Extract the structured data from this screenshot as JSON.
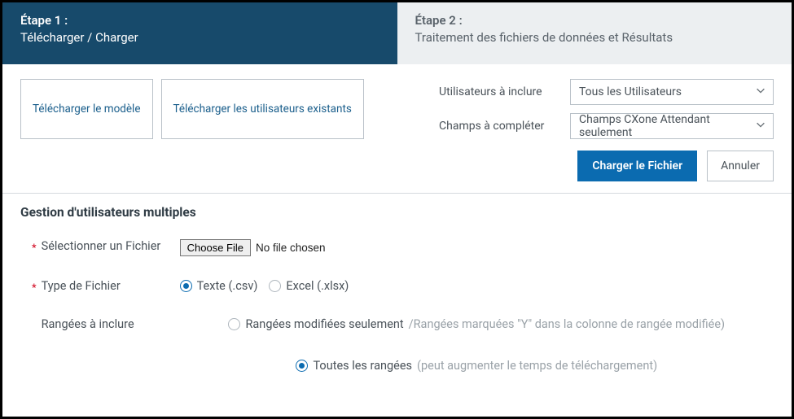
{
  "steps": {
    "step1": {
      "title": "Étape 1 :",
      "subtitle": "Télécharger / Charger"
    },
    "step2": {
      "title": "Étape 2 :",
      "subtitle": "Traitement des fichiers de données et Résultats"
    }
  },
  "buttons": {
    "download_template": "Télécharger le modèle",
    "download_existing": "Télécharger les utilisateurs existants",
    "load_file": "Charger le Fichier",
    "cancel": "Annuler",
    "choose_file": "Choose File",
    "no_file": "No file chosen"
  },
  "fields": {
    "users_to_include": {
      "label": "Utilisateurs à inclure",
      "value": "Tous les Utilisateurs"
    },
    "fields_to_complete": {
      "label": "Champs à compléter",
      "value": "Champs CXone Attendant seulement"
    }
  },
  "section": {
    "title": "Gestion d'utilisateurs multiples",
    "select_file": "Sélectionner un Fichier",
    "file_type": "Type de Fichier",
    "rows_include": "Rangées à inclure"
  },
  "filetype": {
    "csv": "Texte (.csv)",
    "xlsx": "Excel (.xlsx)"
  },
  "rows": {
    "modified": "Rangées modifiées seulement",
    "modified_hint": "/Rangées marquées \"Y\" dans la colonne de rangée modifiée)",
    "all": "Toutes les rangées",
    "all_hint": "(peut augmenter le temps de téléchargement)"
  }
}
